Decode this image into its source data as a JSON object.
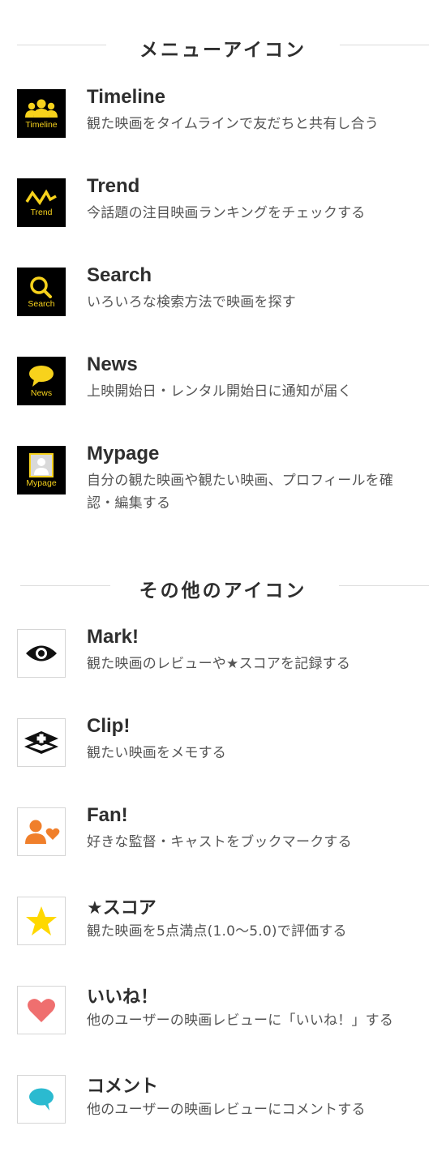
{
  "menu_section": {
    "title": "メニューアイコン",
    "items": [
      {
        "caption": "Timeline",
        "title": "Timeline",
        "desc": "観た映画をタイムラインで友だちと共有し合う",
        "icon": "people-icon"
      },
      {
        "caption": "Trend",
        "title": "Trend",
        "desc": "今話題の注目映画ランキングをチェックする",
        "icon": "trend-zigzag-icon"
      },
      {
        "caption": "Search",
        "title": "Search",
        "desc": "いろいろな検索方法で映画を探す",
        "icon": "magnifier-icon"
      },
      {
        "caption": "News",
        "title": "News",
        "desc": "上映開始日・レンタル開始日に通知が届く",
        "icon": "speech-bubble-icon"
      },
      {
        "caption": "Mypage",
        "title": "Mypage",
        "desc": "自分の観た映画や観たい映画、プロフィールを確認・編集する",
        "icon": "profile-icon"
      }
    ]
  },
  "other_section": {
    "title": "その他のアイコン",
    "items": [
      {
        "title": "Mark!",
        "desc": "観た映画のレビューや★スコアを記録する",
        "icon": "eye-icon"
      },
      {
        "title": "Clip!",
        "desc": "観たい映画をメモする",
        "icon": "clip-plus-icon"
      },
      {
        "title": "Fan!",
        "desc": "好きな監督・キャストをブックマークする",
        "icon": "fan-person-heart-icon"
      },
      {
        "title": "★スコア",
        "desc": "観た映画を5点満点(1.0〜5.0)で評価する",
        "icon": "star-icon"
      },
      {
        "title": "いいね！",
        "desc": "他のユーザーの映画レビューに「いいね！」する",
        "icon": "heart-icon"
      },
      {
        "title": "コメント",
        "desc": "他のユーザーの映画レビューにコメントする",
        "icon": "comment-bubble-icon"
      }
    ]
  },
  "colors": {
    "accent_yellow": "#f7d21c",
    "fan_orange": "#f07f2b",
    "star_yellow": "#ffd800",
    "heart_pink": "#ef6f6f",
    "comment_teal": "#2bbad0"
  }
}
